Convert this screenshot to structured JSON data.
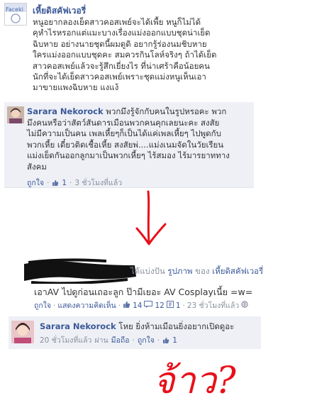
{
  "post": {
    "author": "เหี้ยดิสคัฟเวอรี่",
    "avatar_label": "Faceki",
    "body": "หนูอยากลองเย็ดสาวคอสเพย์จะได้เพื้ย หนูก็ไม่ได้\nคุหำไรหรอกแต่แมะบางเรื่องแม่งออกแบบชุดน่าเย็ด\nฉิบหาย อย่างนายชุดนี้ผมดูดิ อยากรู้ร่องนมชิบหาย\nใครแม่งออกแบบชุดคะ สมควรกินโลห์จริงๆ ถ้าได้เย็ด\nสาวคอสเพย์แล้วจะรู้สึกเยี่ยงไร ที่น่าเศร้าคือน้อยคน\nนักที่จะได้เย็ดสาวคอสเพย์เพราะชุดแม่งหนูเห็นเอา\nมาขายแพงฉิบหาย แงแง้"
  },
  "comment1": {
    "author": "Sarara Nekorock",
    "text": "พวกมึงรู้จักกับคนในรูปหรอคะ พวก\nมึงคนหรือว่าสัตว์สันดารเมือนพวกคนคุกเลยนะคะ สงสัย\nไม่มีความเป็นคน เพลเหี้ยๆก็เป็นได้แค่เพลเหี้ยๆ ไปพูดกับ\nพวกเหี้ย เดี๋ยวติดเชื้อเหี้ย สงสัยพ่....แม่งเนมจัดในวัยเรียน\nแม่งเย็ดกันออกลูกมาเป็นพวกเหี้ยๆ ไร้สมอง ไร้มารยาททาง\nสังคม",
    "like": "ถูกใจ",
    "dot": "·",
    "like_count": "1",
    "time": "3 ชั่วโมงที่แล้ว"
  },
  "share": {
    "shared_text": "ได้แบ่งปัน",
    "photo": "รูปภาพ",
    "of_text": "ของ",
    "page": "เหี้ยดิสคัฟเวอรี่",
    "message": "เอาAV ไปดูก่อนเถอะลูก ป๊ามีเยอะ AV Cosplayเนี้ย =w=",
    "like": "ถูกใจ",
    "dot": "·",
    "comment": "แสดงความคิดเห็น",
    "likes": "14",
    "comments": "12",
    "shares": "1",
    "time": "23 ชั่วโมงที่แล้ว"
  },
  "comment2": {
    "author": "Sarara Nekorock",
    "text": "โหย ยิ่งห้ามเมือนยิ่งอยากเปิดดูอะ",
    "time": "20 ชั่วโมงที่แล้ว",
    "via": "ผ่าน",
    "device": "มือถือ",
    "dot": "·",
    "like": "ถูกใจ",
    "like_count": "1"
  },
  "handwriting": "จ้าว?",
  "colors": {
    "link": "#3b5998",
    "comment_bg": "#eef0f6",
    "muted": "#898f9c",
    "ink_red": "#e8101a"
  }
}
